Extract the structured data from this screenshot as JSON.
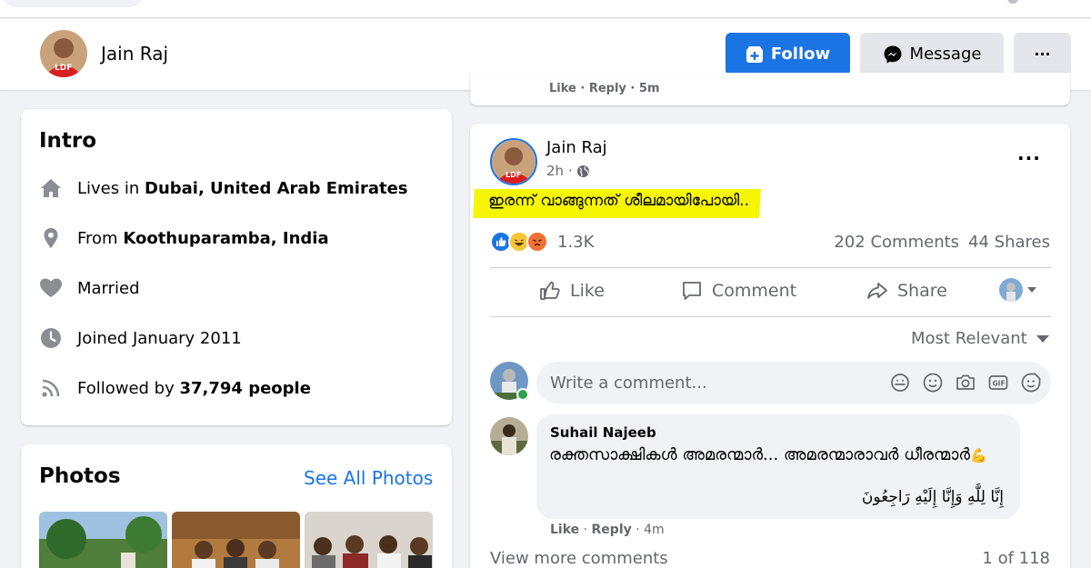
{
  "profile": {
    "name": "Jain Raj",
    "avatar_badge": "LDF",
    "follow_label": "Follow",
    "message_label": "Message",
    "more_label": "···"
  },
  "intro": {
    "title": "Intro",
    "lives_prefix": "Lives in ",
    "lives_place": "Dubai, United Arab Emirates",
    "from_prefix": "From ",
    "from_place": "Koothuparamba, India",
    "relationship": "Married",
    "joined": "Joined January 2011",
    "followed_prefix": "Followed by ",
    "followed_count": "37,794 people"
  },
  "photos": {
    "title": "Photos",
    "see_all": "See All Photos"
  },
  "previous_comment": {
    "actions": "Like · Reply · 5m"
  },
  "post": {
    "author": "Jain Raj",
    "time": "2h ·",
    "more": "···",
    "text": "ഇരന്ന് വാങ്ങുന്നത് ശീലമായിപോയി..",
    "reaction_count": "1.3K",
    "comments_count": "202 Comments",
    "shares_count": "44 Shares",
    "like_label": "Like",
    "comment_label": "Comment",
    "share_label": "Share",
    "sort_label": "Most Relevant",
    "comment_placeholder": "Write a comment...",
    "comment": {
      "author": "Suhail Najeeb",
      "line1": "രക്തസാക്ഷികൾ അമരന്മാർ... അമരന്മാരാവർ ധീരന്മാർ",
      "emoji": "💪",
      "line2": "إِنَّا لِلَّٰهِ وَإِنَّا إِلَيْهِ رَاجِعُونَ",
      "like": "Like",
      "reply": "Reply",
      "time": "4m"
    },
    "view_more": "View more comments",
    "pager": "1 of 118"
  },
  "colors": {
    "brand_blue": "#1b74e4",
    "highlight": "#f6f600",
    "page_bg": "#f0f2f5"
  }
}
